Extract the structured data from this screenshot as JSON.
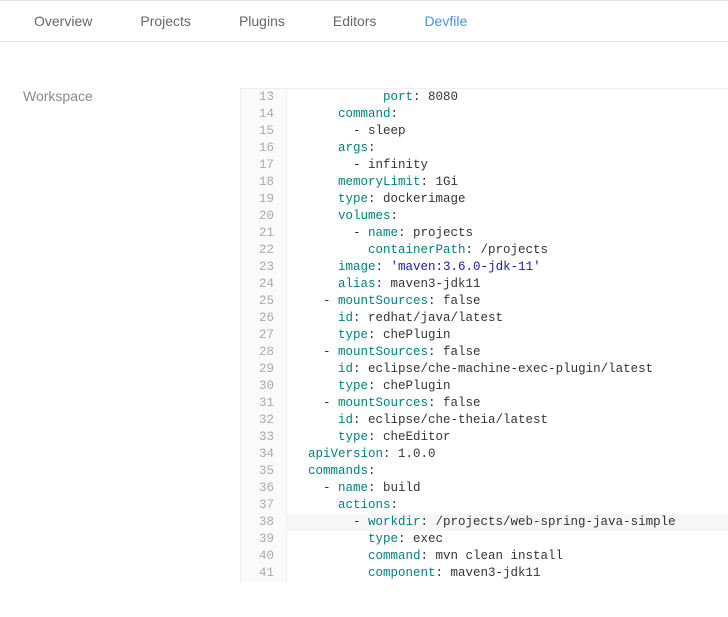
{
  "tabs": [
    {
      "label": "Overview",
      "active": false
    },
    {
      "label": "Projects",
      "active": false
    },
    {
      "label": "Plugins",
      "active": false
    },
    {
      "label": "Editors",
      "active": false
    },
    {
      "label": "Devfile",
      "active": true
    }
  ],
  "sidebar": {
    "title": "Workspace"
  },
  "code": {
    "startLine": 13,
    "highlightLine": 38,
    "lines": [
      [
        {
          "t": "plain",
          "v": "            "
        },
        {
          "t": "key",
          "v": "port"
        },
        {
          "t": "plain",
          "v": ": 8080"
        }
      ],
      [
        {
          "t": "plain",
          "v": "      "
        },
        {
          "t": "key",
          "v": "command"
        },
        {
          "t": "plain",
          "v": ":"
        }
      ],
      [
        {
          "t": "plain",
          "v": "        - sleep"
        }
      ],
      [
        {
          "t": "plain",
          "v": "      "
        },
        {
          "t": "key",
          "v": "args"
        },
        {
          "t": "plain",
          "v": ":"
        }
      ],
      [
        {
          "t": "plain",
          "v": "        - infinity"
        }
      ],
      [
        {
          "t": "plain",
          "v": "      "
        },
        {
          "t": "key",
          "v": "memoryLimit"
        },
        {
          "t": "plain",
          "v": ": 1Gi"
        }
      ],
      [
        {
          "t": "plain",
          "v": "      "
        },
        {
          "t": "key",
          "v": "type"
        },
        {
          "t": "plain",
          "v": ": dockerimage"
        }
      ],
      [
        {
          "t": "plain",
          "v": "      "
        },
        {
          "t": "key",
          "v": "volumes"
        },
        {
          "t": "plain",
          "v": ":"
        }
      ],
      [
        {
          "t": "plain",
          "v": "        - "
        },
        {
          "t": "key",
          "v": "name"
        },
        {
          "t": "plain",
          "v": ": projects"
        }
      ],
      [
        {
          "t": "plain",
          "v": "          "
        },
        {
          "t": "key",
          "v": "containerPath"
        },
        {
          "t": "plain",
          "v": ": /projects"
        }
      ],
      [
        {
          "t": "plain",
          "v": "      "
        },
        {
          "t": "key",
          "v": "image"
        },
        {
          "t": "plain",
          "v": ": "
        },
        {
          "t": "str",
          "v": "'maven:3.6.0-jdk-11'"
        }
      ],
      [
        {
          "t": "plain",
          "v": "      "
        },
        {
          "t": "key",
          "v": "alias"
        },
        {
          "t": "plain",
          "v": ": maven3-jdk11"
        }
      ],
      [
        {
          "t": "plain",
          "v": "    - "
        },
        {
          "t": "key",
          "v": "mountSources"
        },
        {
          "t": "plain",
          "v": ": false"
        }
      ],
      [
        {
          "t": "plain",
          "v": "      "
        },
        {
          "t": "key",
          "v": "id"
        },
        {
          "t": "plain",
          "v": ": redhat/java/latest"
        }
      ],
      [
        {
          "t": "plain",
          "v": "      "
        },
        {
          "t": "key",
          "v": "type"
        },
        {
          "t": "plain",
          "v": ": chePlugin"
        }
      ],
      [
        {
          "t": "plain",
          "v": "    - "
        },
        {
          "t": "key",
          "v": "mountSources"
        },
        {
          "t": "plain",
          "v": ": false"
        }
      ],
      [
        {
          "t": "plain",
          "v": "      "
        },
        {
          "t": "key",
          "v": "id"
        },
        {
          "t": "plain",
          "v": ": eclipse/che-machine-exec-plugin/latest"
        }
      ],
      [
        {
          "t": "plain",
          "v": "      "
        },
        {
          "t": "key",
          "v": "type"
        },
        {
          "t": "plain",
          "v": ": chePlugin"
        }
      ],
      [
        {
          "t": "plain",
          "v": "    - "
        },
        {
          "t": "key",
          "v": "mountSources"
        },
        {
          "t": "plain",
          "v": ": false"
        }
      ],
      [
        {
          "t": "plain",
          "v": "      "
        },
        {
          "t": "key",
          "v": "id"
        },
        {
          "t": "plain",
          "v": ": eclipse/che-theia/latest"
        }
      ],
      [
        {
          "t": "plain",
          "v": "      "
        },
        {
          "t": "key",
          "v": "type"
        },
        {
          "t": "plain",
          "v": ": cheEditor"
        }
      ],
      [
        {
          "t": "plain",
          "v": "  "
        },
        {
          "t": "key",
          "v": "apiVersion"
        },
        {
          "t": "plain",
          "v": ": 1.0.0"
        }
      ],
      [
        {
          "t": "plain",
          "v": "  "
        },
        {
          "t": "key",
          "v": "commands"
        },
        {
          "t": "plain",
          "v": ":"
        }
      ],
      [
        {
          "t": "plain",
          "v": "    - "
        },
        {
          "t": "key",
          "v": "name"
        },
        {
          "t": "plain",
          "v": ": build"
        }
      ],
      [
        {
          "t": "plain",
          "v": "      "
        },
        {
          "t": "key",
          "v": "actions"
        },
        {
          "t": "plain",
          "v": ":"
        }
      ],
      [
        {
          "t": "plain",
          "v": "        - "
        },
        {
          "t": "key",
          "v": "workdir"
        },
        {
          "t": "plain",
          "v": ": /projects/web-spring-java-simple"
        }
      ],
      [
        {
          "t": "plain",
          "v": "          "
        },
        {
          "t": "key",
          "v": "type"
        },
        {
          "t": "plain",
          "v": ": exec"
        }
      ],
      [
        {
          "t": "plain",
          "v": "          "
        },
        {
          "t": "key",
          "v": "command"
        },
        {
          "t": "plain",
          "v": ": mvn clean install"
        }
      ],
      [
        {
          "t": "plain",
          "v": "          "
        },
        {
          "t": "key",
          "v": "component"
        },
        {
          "t": "plain",
          "v": ": maven3-jdk11"
        }
      ]
    ]
  }
}
